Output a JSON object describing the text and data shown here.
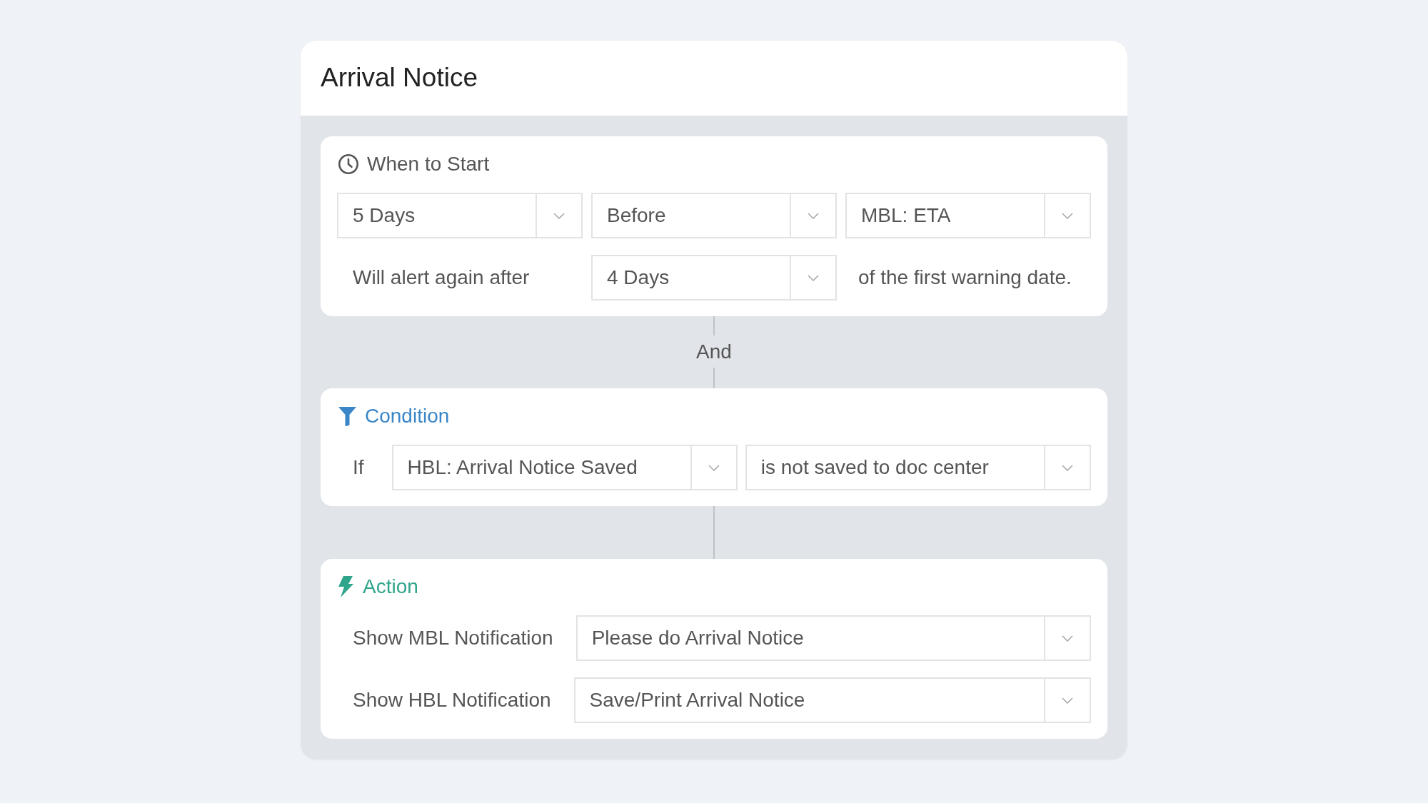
{
  "title": "Arrival Notice",
  "flow": [
    {
      "kind": "trigger",
      "heading": "When to Start",
      "color": "#555555",
      "rows": [
        {
          "cells": [
            {
              "kind": "select",
              "value": "5 Days"
            },
            {
              "kind": "select",
              "value": "Before"
            },
            {
              "kind": "select",
              "value": "MBL: ETA"
            }
          ]
        },
        {
          "cells": [
            {
              "kind": "label",
              "text": "Will alert again after"
            },
            {
              "kind": "select",
              "value": "4 Days"
            },
            {
              "kind": "label",
              "text": "of the first warning date."
            }
          ]
        }
      ]
    },
    {
      "kind": "connector",
      "label": "And"
    },
    {
      "kind": "condition",
      "heading": "Condition",
      "color": "#3a86c8",
      "rows": [
        {
          "cells": [
            {
              "kind": "label",
              "text": "If"
            },
            {
              "kind": "select",
              "value": "HBL: Arrival Notice Saved"
            },
            {
              "kind": "select",
              "value": "is not saved to doc center"
            }
          ]
        }
      ]
    },
    {
      "kind": "connector"
    },
    {
      "kind": "action",
      "heading": "Action",
      "color": "#2fa58b",
      "rows": [
        {
          "cells": [
            {
              "kind": "label",
              "text": "Show MBL Notification"
            },
            {
              "kind": "select",
              "value": "Please do Arrival Notice"
            }
          ]
        },
        {
          "cells": [
            {
              "kind": "label",
              "text": "Show HBL Notification"
            },
            {
              "kind": "select",
              "value": "Save/Print Arrival Notice"
            }
          ]
        }
      ]
    }
  ]
}
